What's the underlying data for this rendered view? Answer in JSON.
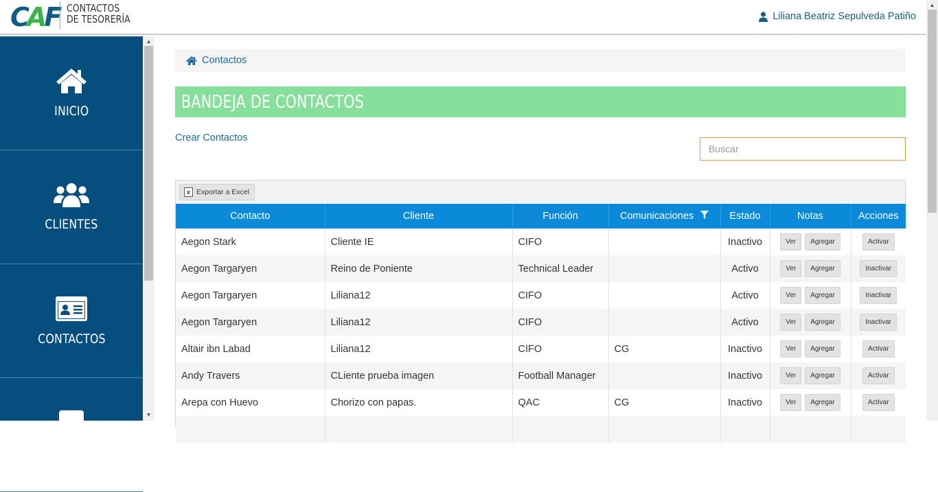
{
  "header": {
    "logo_text": "CAF",
    "app_name_line1": "CONTACTOS",
    "app_name_line2": "DE TESORERÍA",
    "user_name": "Liliana Beatriz Sepulveda Patiño"
  },
  "sidebar": {
    "items": [
      {
        "label": "INICIO",
        "icon": "home-icon"
      },
      {
        "label": "CLIENTES",
        "icon": "users-icon"
      },
      {
        "label": "CONTACTOS",
        "icon": "id-card-icon"
      },
      {
        "label": "",
        "icon": "partial-icon"
      }
    ]
  },
  "breadcrumb": {
    "label": "Contactos",
    "icon": "home-icon"
  },
  "page_title": "BANDEJA DE CONTACTOS",
  "create_link": "Crear Contactos",
  "search": {
    "placeholder": "Buscar",
    "value": ""
  },
  "toolbar": {
    "export_label": "Exportar a Excel",
    "export_icon": "excel-icon"
  },
  "table": {
    "columns": [
      "Contacto",
      "Cliente",
      "Función",
      "Comunicaciones",
      "Estado",
      "Notas",
      "Acciones"
    ],
    "notes_buttons": [
      "Ver",
      "Agregar"
    ],
    "rows": [
      {
        "contacto": "Aegon Stark",
        "cliente": "Cliente IE",
        "funcion": "CIFO",
        "comunicaciones": "",
        "estado": "Inactivo",
        "accion": "Activar"
      },
      {
        "contacto": "Aegon Targaryen",
        "cliente": "Reino de Poniente",
        "funcion": "Technical Leader",
        "comunicaciones": "",
        "estado": "Activo",
        "accion": "Inactivar"
      },
      {
        "contacto": "Aegon Targaryen",
        "cliente": "Liliana12",
        "funcion": "CIFO",
        "comunicaciones": "",
        "estado": "Activo",
        "accion": "Inactivar"
      },
      {
        "contacto": "Aegon Targaryen",
        "cliente": "Liliana12",
        "funcion": "CIFO",
        "comunicaciones": "",
        "estado": "Activo",
        "accion": "Inactivar"
      },
      {
        "contacto": "Altair ibn Labad",
        "cliente": "Liliana12",
        "funcion": "CIFO",
        "comunicaciones": "CG",
        "estado": "Inactivo",
        "accion": "Activar"
      },
      {
        "contacto": "Andy Travers",
        "cliente": "CLiente prueba imagen",
        "funcion": "Football Manager",
        "comunicaciones": "",
        "estado": "Inactivo",
        "accion": "Activar"
      },
      {
        "contacto": "Arepa con Huevo",
        "cliente": "Chorizo con papas.",
        "funcion": "QAC",
        "comunicaciones": "CG",
        "estado": "Inactivo",
        "accion": "Activar"
      },
      {
        "contacto": "",
        "cliente": "",
        "funcion": "",
        "comunicaciones": "",
        "estado": "",
        "accion": ""
      }
    ]
  },
  "colors": {
    "sidebar_bg": "#064e7e",
    "title_bar_bg": "#86e09c",
    "table_header_bg": "#0b8ad9",
    "link": "#1a6d9c",
    "search_border": "#d99b3b"
  }
}
